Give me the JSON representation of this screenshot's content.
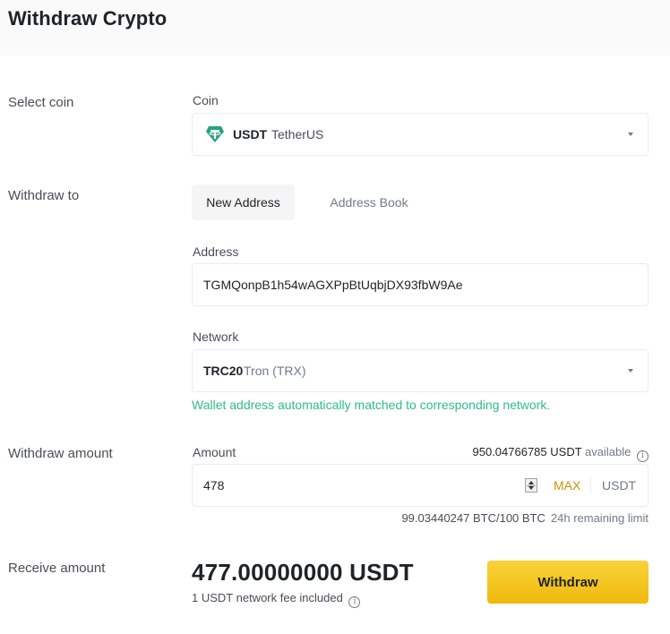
{
  "header": {
    "title": "Withdraw Crypto"
  },
  "rows": {
    "select_coin": "Select coin",
    "withdraw_to": "Withdraw to",
    "withdraw_amount": "Withdraw amount",
    "receive_amount": "Receive amount"
  },
  "coin": {
    "label": "Coin",
    "icon": "tether-icon",
    "icon_color": "#26a17b",
    "symbol": "USDT",
    "name": "TetherUS"
  },
  "withdraw_to": {
    "tabs": [
      {
        "label": "New Address",
        "active": true
      },
      {
        "label": "Address Book",
        "active": false
      }
    ]
  },
  "address": {
    "label": "Address",
    "value": "TGMQonpB1h54wAGXPpBtUqbjDX93fbW9Ae"
  },
  "network": {
    "label": "Network",
    "code": "TRC20",
    "name": "Tron (TRX)",
    "match_message": "Wallet address automatically matched to corresponding network.",
    "match_color": "#2ebd85"
  },
  "amount": {
    "label": "Amount",
    "available_amount": "950.04766785 USDT",
    "available_label": "available",
    "value": "478",
    "max_label": "MAX",
    "unit": "USDT",
    "limit_value": "99.03440247 BTC/100 BTC",
    "limit_label": "24h remaining limit"
  },
  "receive": {
    "amount": "477.00000000 USDT",
    "fee_note": "1 USDT network fee included"
  },
  "actions": {
    "withdraw_label": "Withdraw",
    "accent_color": "#f0b90b"
  }
}
